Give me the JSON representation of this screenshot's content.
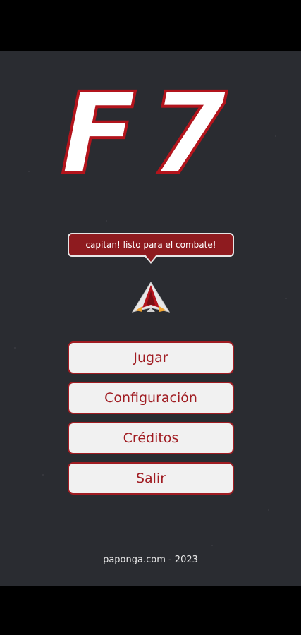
{
  "app": {
    "logo_text": "F7"
  },
  "speech_bubble": {
    "text": "capitan! listo para el combate!"
  },
  "ship": {
    "icon": "spaceship-icon"
  },
  "menu": {
    "items": [
      {
        "label": "Jugar"
      },
      {
        "label": "Configuración"
      },
      {
        "label": "Créditos"
      },
      {
        "label": "Salir"
      }
    ]
  },
  "footer": {
    "text": "paponga.com - 2023"
  },
  "colors": {
    "background": "#2a2c31",
    "accent": "#a01c22",
    "button_bg": "#f1f1f1",
    "bubble_bg": "#8e1b1f"
  }
}
